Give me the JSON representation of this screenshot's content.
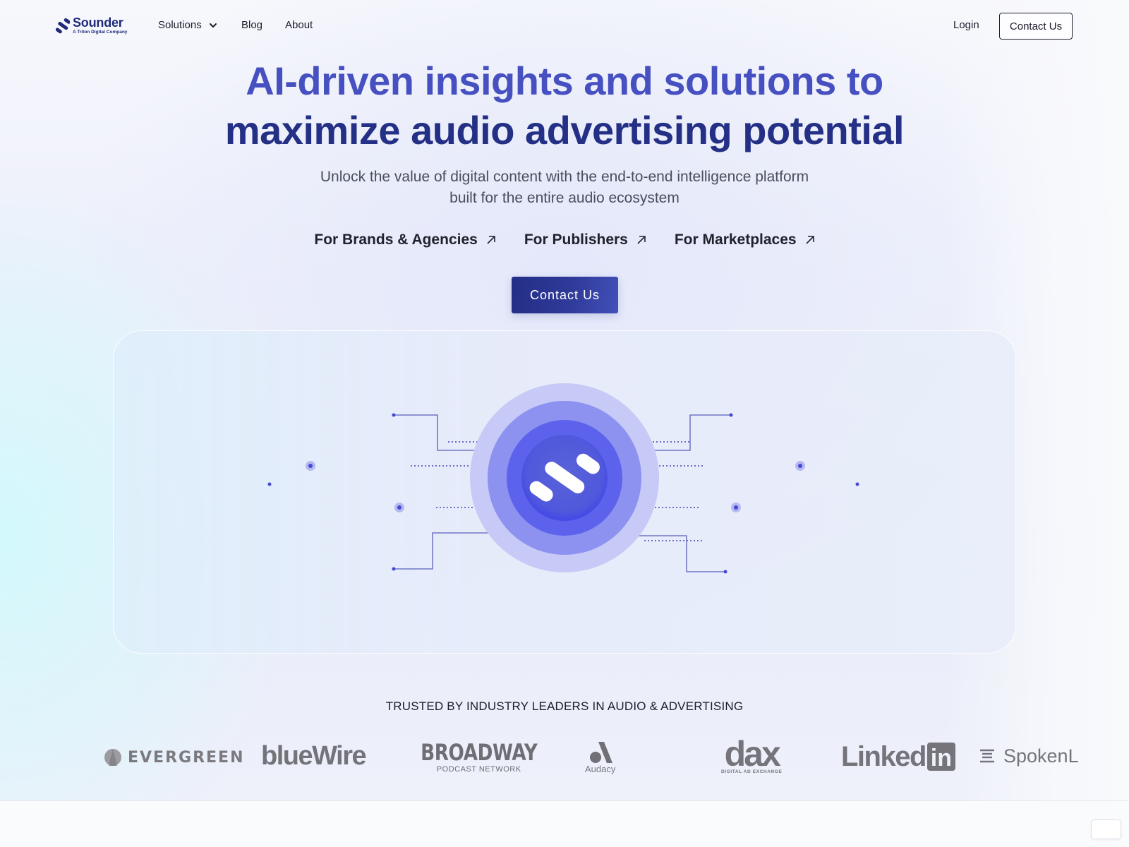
{
  "brand": {
    "name": "Sounder",
    "tagline": "A Triton Digital Company",
    "colors": {
      "primary": "#242f86",
      "accent": "#4650c0",
      "illustration": "#5b5fe8"
    }
  },
  "nav": {
    "items": [
      {
        "label": "Solutions",
        "has_dropdown": true,
        "icon": "chevron-down-icon"
      },
      {
        "label": "Blog"
      },
      {
        "label": "About"
      }
    ],
    "login_label": "Login",
    "contact_label": "Contact Us"
  },
  "hero": {
    "headline_line1": "AI-driven insights and solutions to",
    "headline_line2": "maximize audio advertising potential",
    "subhead_line1": "Unlock the value of digital content with the end-to-end intelligence platform",
    "subhead_line2": "built for the entire audio ecosystem",
    "segments": [
      {
        "label": "For Brands & Agencies",
        "icon": "arrow-up-right-icon"
      },
      {
        "label": "For Publishers",
        "icon": "arrow-up-right-icon"
      },
      {
        "label": "For Marketplaces",
        "icon": "arrow-up-right-icon"
      }
    ],
    "cta_label": "Contact Us"
  },
  "trusted": {
    "heading": "TRUSTED BY INDUSTRY LEADERS IN AUDIO & ADVERTISING",
    "partners": [
      {
        "name": "EVERGREEN",
        "mark": "®"
      },
      {
        "name": "blueWire"
      },
      {
        "name": "BROADWAY",
        "sub": "PODCAST NETWORK"
      },
      {
        "name": "Audacy"
      },
      {
        "name": "dax",
        "sub": "DIGITAL AD EXCHANGE"
      },
      {
        "name": "Linked",
        "badge": "in"
      },
      {
        "name": "SpokenL"
      }
    ]
  }
}
